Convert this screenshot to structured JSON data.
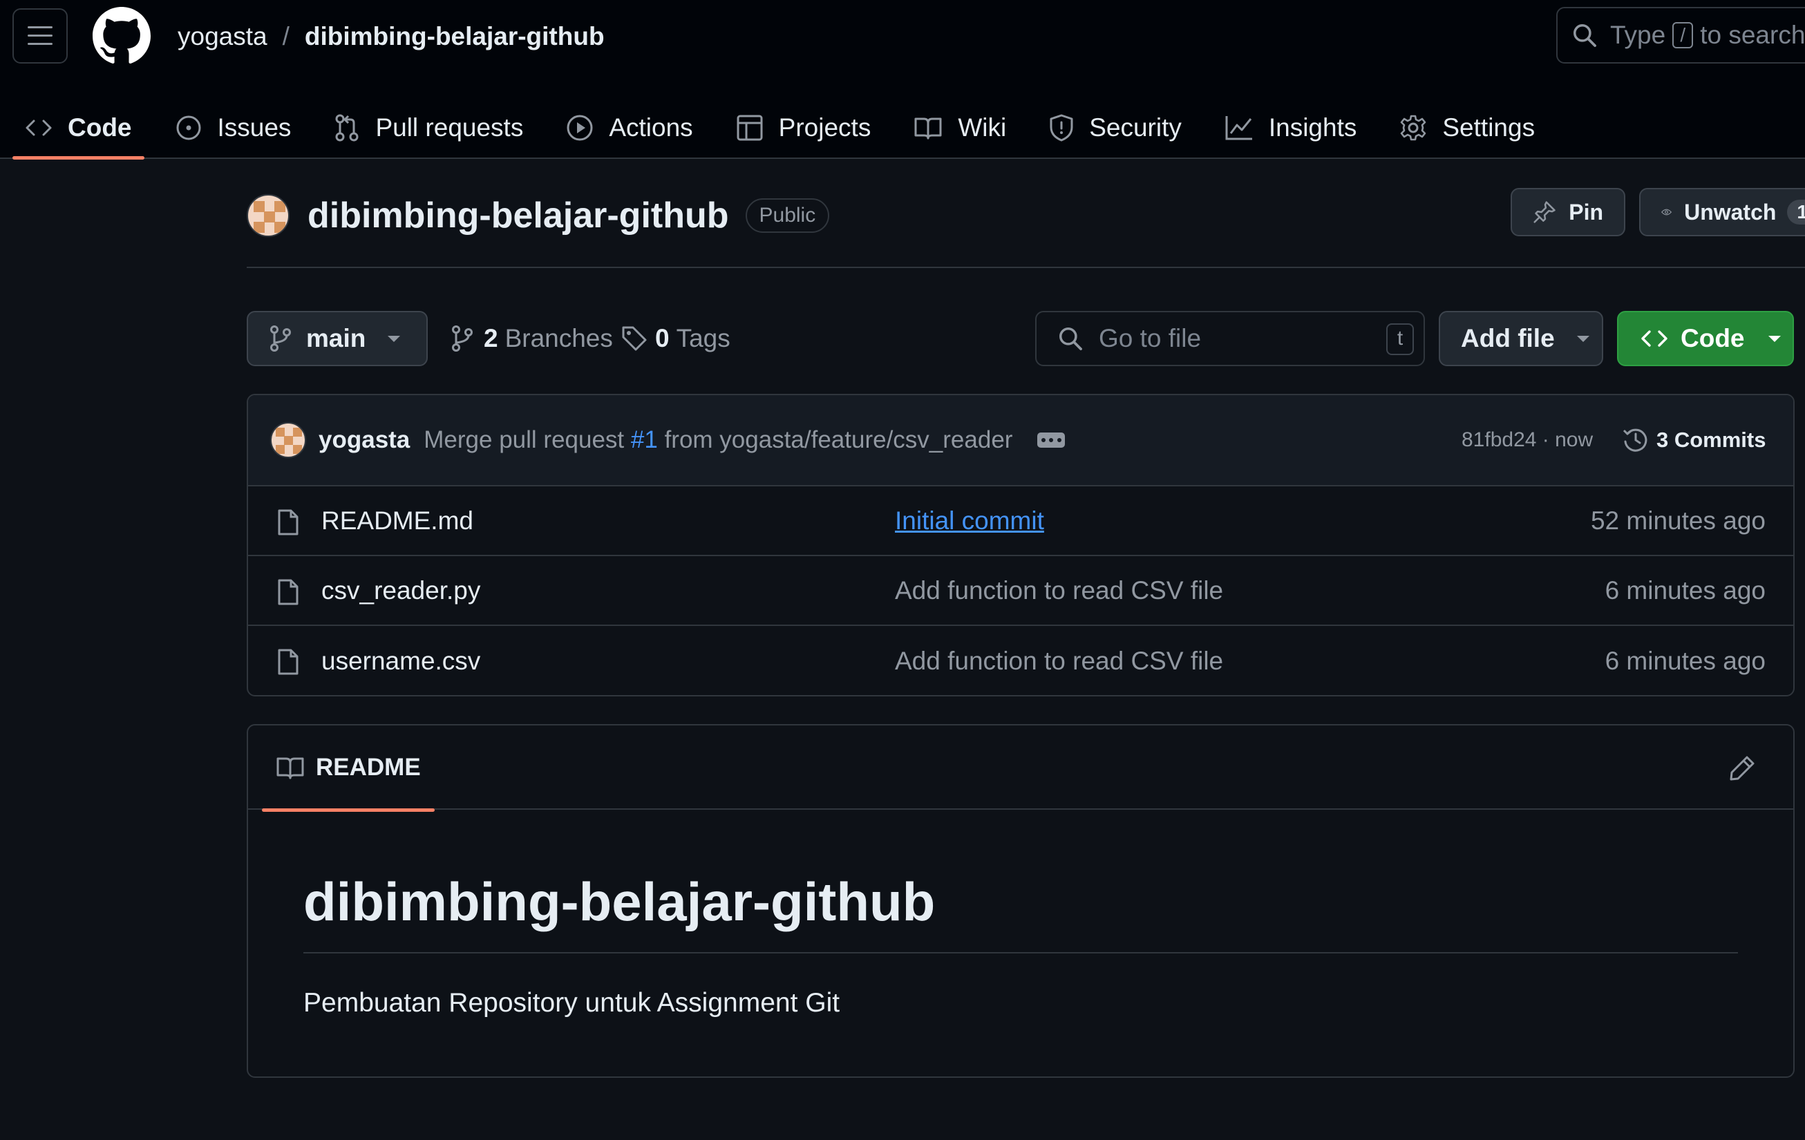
{
  "header": {
    "owner": "yogasta",
    "separator": "/",
    "repo": "dibimbing-belajar-github",
    "search": {
      "prefix": "Type",
      "key": "/",
      "suffix": "to search"
    }
  },
  "tabs": [
    {
      "label": "Code",
      "icon": "code-icon",
      "active": true
    },
    {
      "label": "Issues",
      "icon": "issue-icon"
    },
    {
      "label": "Pull requests",
      "icon": "pull-request-icon"
    },
    {
      "label": "Actions",
      "icon": "play-icon"
    },
    {
      "label": "Projects",
      "icon": "table-icon"
    },
    {
      "label": "Wiki",
      "icon": "book-icon"
    },
    {
      "label": "Security",
      "icon": "shield-icon"
    },
    {
      "label": "Insights",
      "icon": "graph-icon"
    },
    {
      "label": "Settings",
      "icon": "gear-icon"
    }
  ],
  "repo_header": {
    "name": "dibimbing-belajar-github",
    "visibility": "Public",
    "pin_label": "Pin",
    "unwatch_label": "Unwatch",
    "watch_count": "1"
  },
  "branch_bar": {
    "branch": "main",
    "branches_count": "2",
    "branches_label": "Branches",
    "tags_count": "0",
    "tags_label": "Tags",
    "go_to_file_placeholder": "Go to file",
    "go_to_file_key": "t",
    "add_file_label": "Add file",
    "code_label": "Code"
  },
  "latest_commit": {
    "author": "yogasta",
    "message_prefix": "Merge pull request",
    "pr_ref": "#1",
    "message_suffix": "from yogasta/feature/csv_reader",
    "sha_time": "81fbd24 · now",
    "commits_label": "3 Commits"
  },
  "files": [
    {
      "name": "README.md",
      "message": "Initial commit",
      "time": "52 minutes ago",
      "message_is_link": true
    },
    {
      "name": "csv_reader.py",
      "message": "Add function to read CSV file",
      "time": "6 minutes ago"
    },
    {
      "name": "username.csv",
      "message": "Add function to read CSV file",
      "time": "6 minutes ago"
    }
  ],
  "readme": {
    "tab_label": "README",
    "heading": "dibimbing-belajar-github",
    "paragraph": "Pembuatan Repository untuk Assignment Git"
  },
  "colors": {
    "background": "#0d1117",
    "header_bg": "#010409",
    "accent_green": "#238636",
    "link_blue": "#4493f8",
    "tab_underline": "#f78166"
  }
}
